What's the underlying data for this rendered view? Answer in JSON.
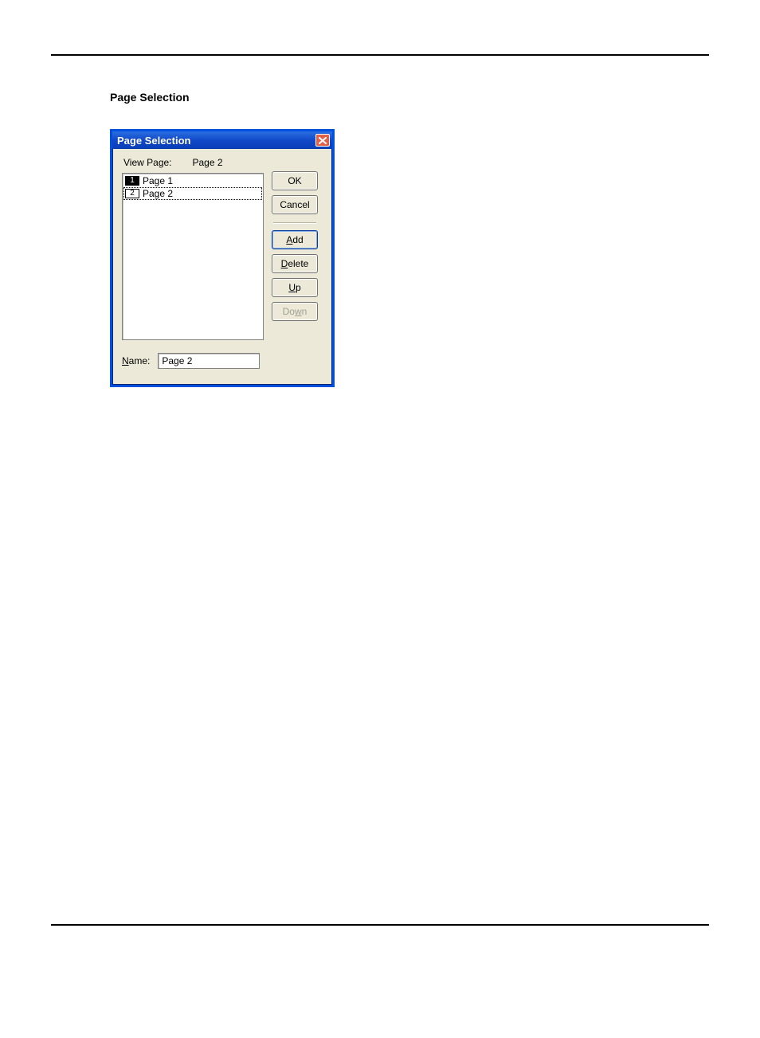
{
  "heading": "Page Selection",
  "dialog": {
    "title": "Page Selection",
    "viewPageLabel_pre": "V",
    "viewPageLabel_post": "iew Page:",
    "viewPageValue": "Page 2",
    "listItems": [
      {
        "index": "1",
        "label": "Page 1",
        "highlighted": true,
        "selected": false
      },
      {
        "index": "2",
        "label": "Page 2",
        "highlighted": false,
        "selected": true
      }
    ],
    "buttons": {
      "ok": "OK",
      "cancel": "Cancel",
      "add_pre": "A",
      "add_post": "dd",
      "delete_pre": "D",
      "delete_post": "elete",
      "up_pre": "U",
      "up_post": "p",
      "down_pre": "Do",
      "down_mid": "w",
      "down_post": "n",
      "downDisabled": true
    },
    "nameLabel_pre": "N",
    "nameLabel_post": "ame:",
    "nameValue": "Page 2"
  }
}
